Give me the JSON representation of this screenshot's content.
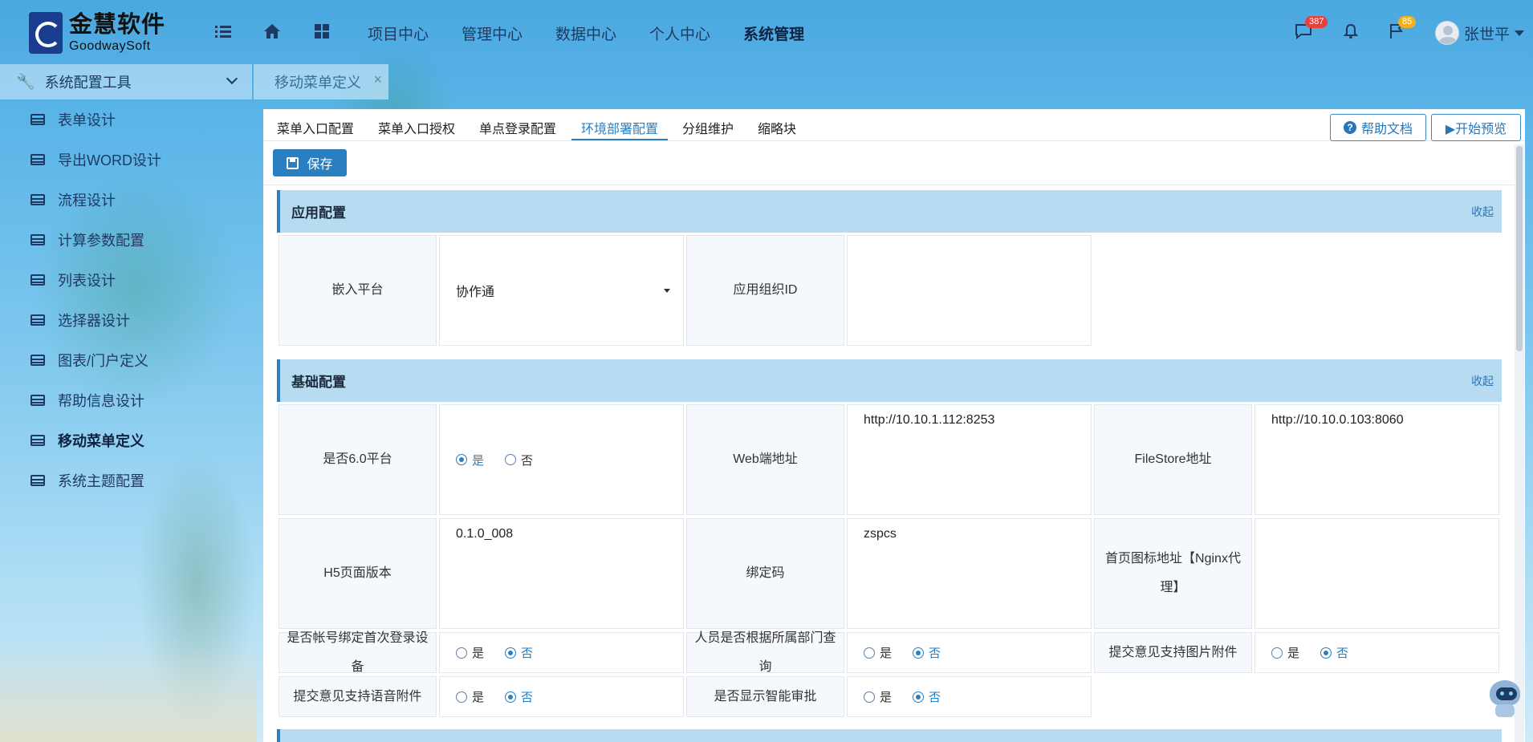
{
  "colors": {
    "accent": "#2a7fc0",
    "header_bg": "#4aa8e0",
    "section_bg": "#b7dcf2",
    "badge_red": "#e8403a",
    "badge_yellow": "#f2b01e"
  },
  "logo": {
    "cn": "金慧软件",
    "en": "GoodwaySoft"
  },
  "header": {
    "icons": [
      "list-icon",
      "home-icon",
      "apps-grid-icon"
    ],
    "nav": [
      "项目中心",
      "管理中心",
      "数据中心",
      "个人中心",
      "系统管理"
    ],
    "active_nav": "系统管理",
    "messages_badge": "387",
    "flag_badge": "85",
    "user_name": "张世平"
  },
  "sidebar": {
    "group_title": "系统配置工具",
    "items": [
      {
        "label": "表单设计"
      },
      {
        "label": "导出WORD设计"
      },
      {
        "label": "流程设计"
      },
      {
        "label": "计算参数配置"
      },
      {
        "label": "列表设计"
      },
      {
        "label": "选择器设计"
      },
      {
        "label": "图表/门户定义"
      },
      {
        "label": "帮助信息设计"
      },
      {
        "label": "移动菜单定义"
      },
      {
        "label": "系统主题配置"
      }
    ],
    "active_item": "移动菜单定义"
  },
  "page_tab": {
    "label": "移动菜单定义",
    "close": "×"
  },
  "subtabs": {
    "items": [
      "菜单入口配置",
      "菜单入口授权",
      "单点登录配置",
      "环境部署配置",
      "分组维护",
      "缩略块"
    ],
    "active": "环境部署配置"
  },
  "buttons": {
    "help": "帮助文档",
    "preview": "▶开始预览",
    "save": "保存"
  },
  "app_config": {
    "title": "应用配置",
    "collapse": "收起",
    "platform_label": "嵌入平台",
    "platform_value": "协作通",
    "org_id_label": "应用组织ID",
    "org_id_value": ""
  },
  "basic_config": {
    "title": "基础配置",
    "collapse": "收起",
    "is_v6_label": "是否6.0平台",
    "web_label": "Web端地址",
    "web_value": "http://10.10.1.112:8253",
    "filestore_label": "FileStore地址",
    "filestore_value": "http://10.10.0.103:8060",
    "h5_label": "H5页面版本",
    "h5_value": "0.1.0_008",
    "bind_label": "绑定码",
    "bind_value": "zspcs",
    "icon_label": "首页图标地址【Nginx代理】",
    "icon_value": "",
    "device_bind_label": "是否帐号绑定首次登录设备",
    "dept_query_label": "人员是否根据所属部门查询",
    "img_attach_label": "提交意见支持图片附件",
    "voice_attach_label": "提交意见支持语音附件",
    "smart_audit_label": "是否显示智能审批",
    "yes": "是",
    "no": "否",
    "values": {
      "is_v6": "是",
      "device_bind": "否",
      "dept_query": "否",
      "img_attach": "否",
      "voice_attach": "否",
      "smart_audit": "否"
    }
  }
}
